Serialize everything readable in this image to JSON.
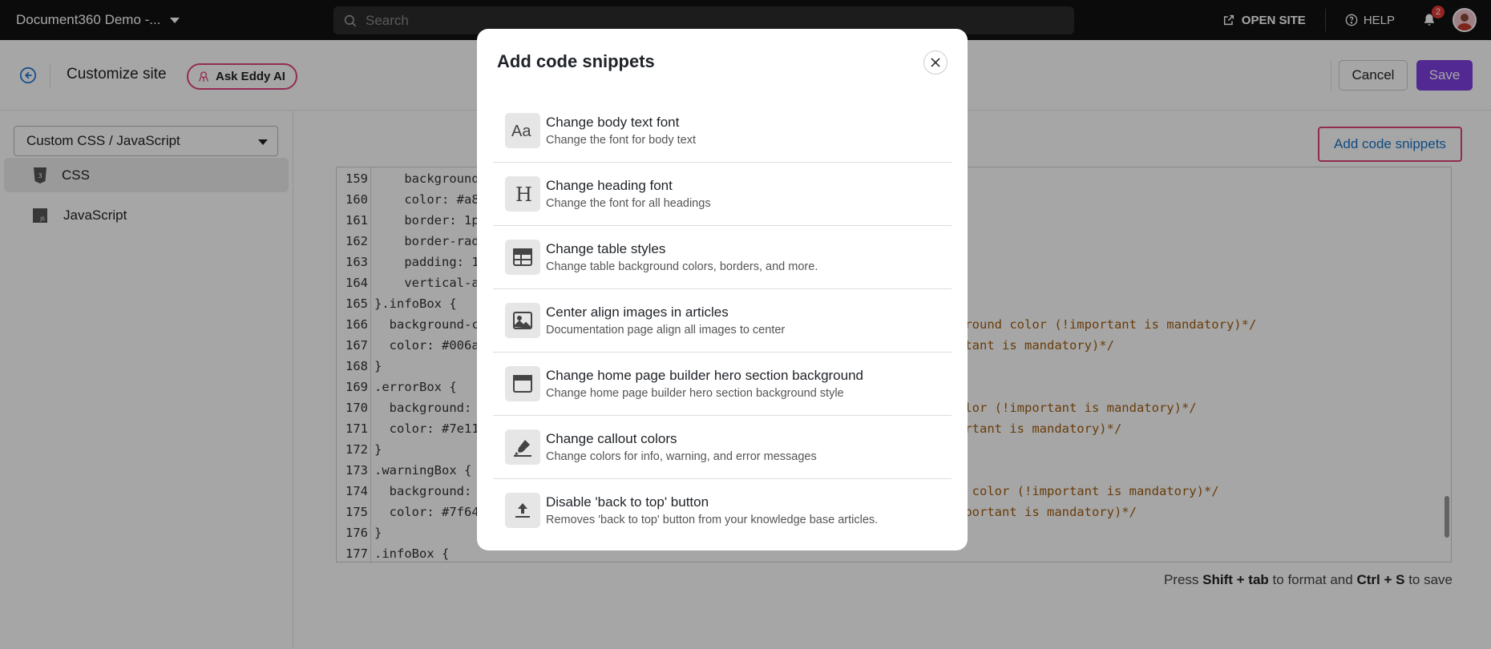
{
  "topbar": {
    "project_name": "Document360 Demo -...",
    "search_placeholder": "Search",
    "open_site": "OPEN SITE",
    "help": "HELP",
    "notification_count": "2"
  },
  "header": {
    "title": "Customize site",
    "ask_eddy": "Ask Eddy AI",
    "cancel": "Cancel",
    "save": "Save"
  },
  "sidebar": {
    "select_value": "Custom CSS / JavaScript",
    "items": [
      {
        "label": "CSS",
        "icon": "css3-icon"
      },
      {
        "label": "JavaScript",
        "icon": "js-icon"
      }
    ]
  },
  "main": {
    "add_snippets_button": "Add code snippets",
    "hint": {
      "press": "Press",
      "key1": "Shift + tab",
      "mid": "to format and",
      "key2": "Ctrl + S",
      "end": "to save"
    },
    "code_lines": [
      {
        "n": "159",
        "code": "    background",
        "comment": ""
      },
      {
        "n": "160",
        "code": "    color: #a8",
        "comment": ""
      },
      {
        "n": "161",
        "code": "    border: 1p",
        "comment": ""
      },
      {
        "n": "162",
        "code": "    border-rad",
        "comment": ""
      },
      {
        "n": "163",
        "code": "    padding: 1",
        "comment": ""
      },
      {
        "n": "164",
        "code": "    vertical-a",
        "comment": ""
      },
      {
        "n": "165",
        "code": "}.infoBox {",
        "comment": ""
      },
      {
        "n": "166",
        "code": "  background-c",
        "comment": "ground color (!important is mandatory)*/"
      },
      {
        "n": "167",
        "code": "  color: #006a",
        "comment": "rtant is mandatory)*/"
      },
      {
        "n": "168",
        "code": "}",
        "comment": ""
      },
      {
        "n": "169",
        "code": ".errorBox {",
        "comment": ""
      },
      {
        "n": "170",
        "code": "  background:",
        "comment": "olor (!important is mandatory)*/"
      },
      {
        "n": "171",
        "code": "  color: #7e11",
        "comment": "ortant is mandatory)*/"
      },
      {
        "n": "172",
        "code": "}",
        "comment": ""
      },
      {
        "n": "173",
        "code": ".warningBox {",
        "comment": ""
      },
      {
        "n": "174",
        "code": "  background:",
        "comment": "d color (!important is mandatory)*/"
      },
      {
        "n": "175",
        "code": "  color: #7f64",
        "comment": "mportant is mandatory)*/"
      },
      {
        "n": "176",
        "code": "}",
        "comment": ""
      },
      {
        "n": "177",
        "code": ".infoBox {",
        "comment": ""
      }
    ]
  },
  "modal": {
    "title": "Add code snippets",
    "snippets": [
      {
        "icon": "font-icon",
        "title": "Change body text font",
        "desc": "Change the font for body text"
      },
      {
        "icon": "heading-icon",
        "title": "Change heading font",
        "desc": "Change the font for all headings"
      },
      {
        "icon": "table-icon",
        "title": "Change table styles",
        "desc": "Change table background colors, borders, and more."
      },
      {
        "icon": "image-icon",
        "title": "Center align images in articles",
        "desc": "Documentation page align all images to center"
      },
      {
        "icon": "hero-section-icon",
        "title": "Change home page builder hero section background",
        "desc": "Change home page builder hero section background style"
      },
      {
        "icon": "highlighter-icon",
        "title": "Change callout colors",
        "desc": "Change colors for info, warning, and error messages"
      },
      {
        "icon": "upload-icon",
        "title": "Disable 'back to top' button",
        "desc": "Removes 'back to top' button from your knowledge base articles."
      }
    ]
  }
}
